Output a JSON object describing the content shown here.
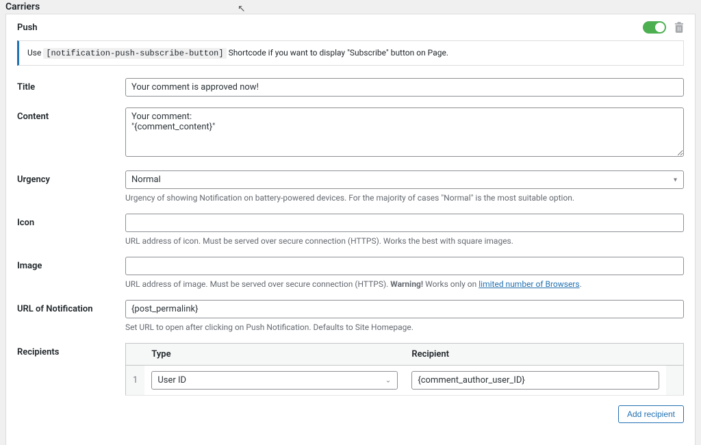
{
  "page_title": "Carriers",
  "carrier": {
    "name": "Push",
    "enabled": true,
    "info_prefix": "Use",
    "info_shortcode": "[notification-push-subscribe-button]",
    "info_suffix": "Shortcode if you want to display \"Subscribe\" button on Page."
  },
  "fields": {
    "title": {
      "label": "Title",
      "value": "Your comment is approved now!"
    },
    "content": {
      "label": "Content",
      "value": "Your comment:\n\"{comment_content}\""
    },
    "urgency": {
      "label": "Urgency",
      "value": "Normal",
      "help": "Urgency of showing Notification on battery-powered devices. For the majority of cases \"Normal\" is the most suitable option."
    },
    "icon": {
      "label": "Icon",
      "value": "",
      "help": "URL address of icon. Must be served over secure connection (HTTPS). Works the best with square images."
    },
    "image": {
      "label": "Image",
      "value": "",
      "help_prefix": "URL address of image. Must be served over secure connection (HTTPS). ",
      "help_warning": "Warning!",
      "help_mid": " Works only on ",
      "help_link": "limited number of Browsers",
      "help_suffix": "."
    },
    "url": {
      "label": "URL of Notification",
      "value": "{post_permalink}",
      "help": "Set URL to open after clicking on Push Notification. Defaults to Site Homepage."
    },
    "recipients": {
      "label": "Recipients",
      "columns": {
        "type": "Type",
        "recipient": "Recipient"
      },
      "rows": [
        {
          "idx": "1",
          "type": "User ID",
          "recipient": "{comment_author_user_ID}"
        }
      ],
      "add_button": "Add recipient"
    }
  }
}
